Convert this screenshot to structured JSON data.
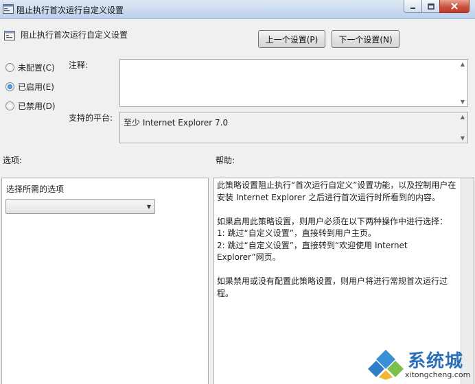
{
  "window": {
    "title": "阻止执行首次运行自定义设置",
    "min_icon": "minimize-icon",
    "max_icon": "maximize-icon",
    "close_icon": "close-icon"
  },
  "header": {
    "setting_title": "阻止执行首次运行自定义设置",
    "prev_button": "上一个设置(P)",
    "next_button": "下一个设置(N)"
  },
  "state": {
    "options": [
      {
        "label": "未配置(C)",
        "checked": false
      },
      {
        "label": "已启用(E)",
        "checked": true
      },
      {
        "label": "已禁用(D)",
        "checked": false
      }
    ]
  },
  "comment": {
    "label": "注释:",
    "value": ""
  },
  "platform": {
    "label": "支持的平台:",
    "value": "至少 Internet Explorer 7.0"
  },
  "options_section": {
    "label": "选项:",
    "select_label": "选择所需的选项",
    "select_value": ""
  },
  "help_section": {
    "label": "帮助:",
    "text": "此策略设置阻止执行“首次运行自定义”设置功能，以及控制用户在安装 Internet Explorer 之后进行首次运行时所看到的内容。\n\n如果启用此策略设置，则用户必须在以下两种操作中进行选择：\n1: 跳过“自定义设置”，直接转到用户主页。\n2: 跳过“自定义设置”，直接转到“欢迎使用 Internet Explorer”网页。\n\n如果禁用或没有配置此策略设置，则用户将进行常规首次运行过程。"
  },
  "watermark": {
    "brand": "系统城",
    "url": "xitongcheng.com"
  },
  "colors": {
    "accent": "#2a6fb7",
    "close": "#c0392b"
  }
}
